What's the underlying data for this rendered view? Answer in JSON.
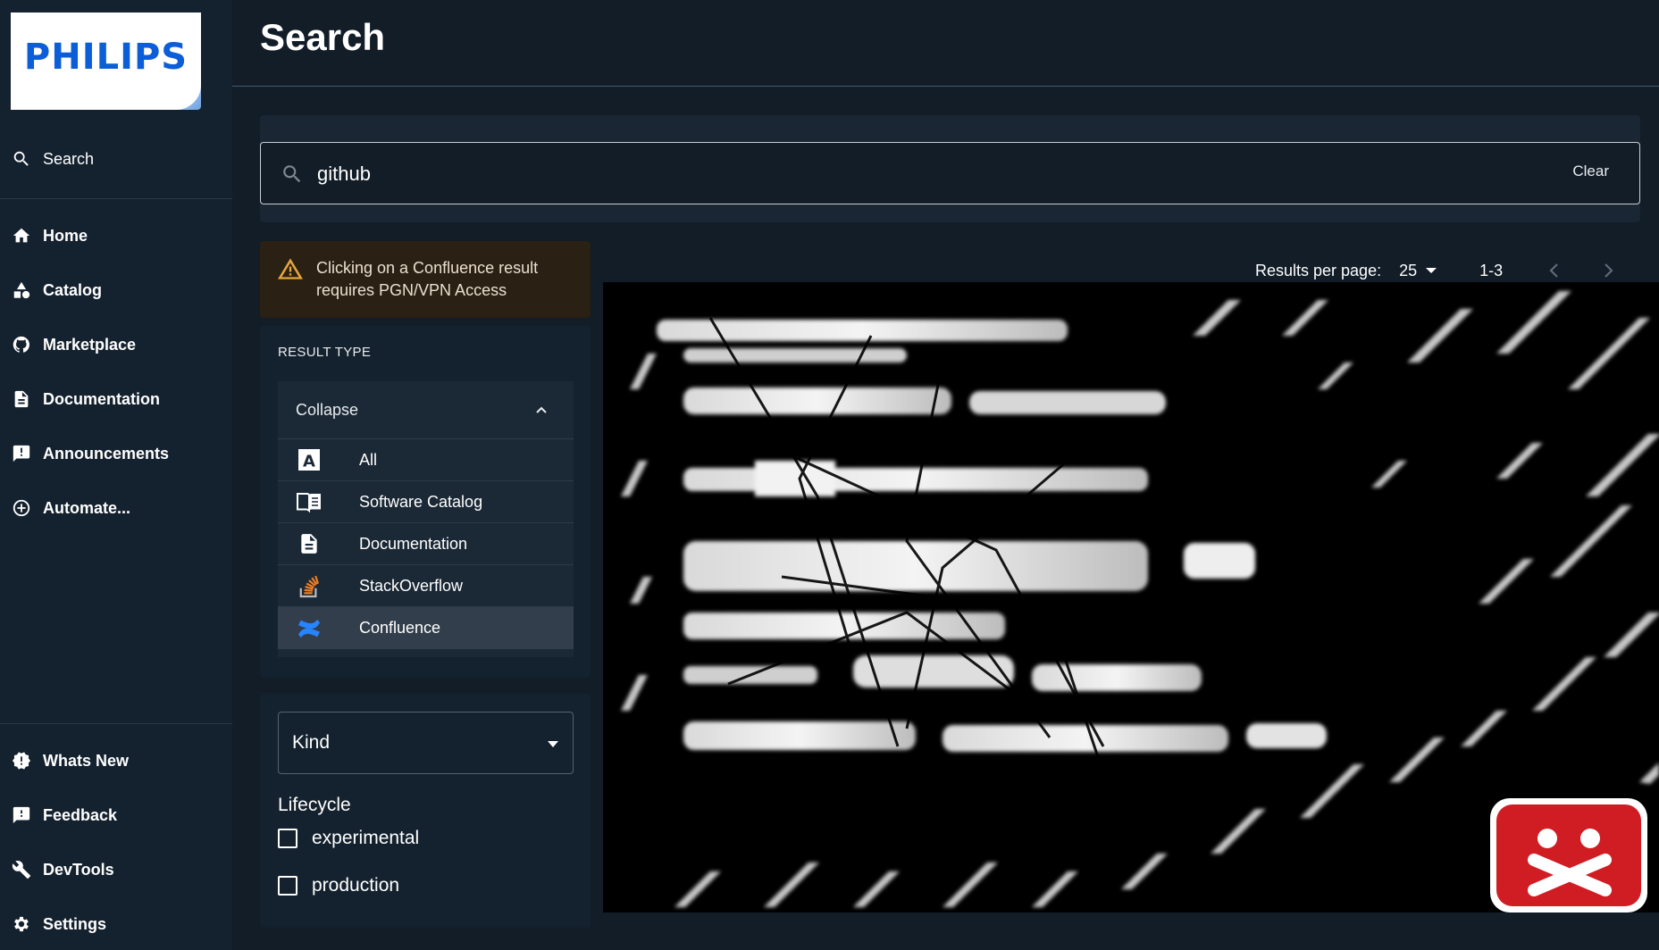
{
  "brand": {
    "logo_text": "PHILIPS"
  },
  "sidebar": {
    "search_label": "Search",
    "items": [
      {
        "label": "Home",
        "icon": "home-icon"
      },
      {
        "label": "Catalog",
        "icon": "catalog-icon"
      },
      {
        "label": "Marketplace",
        "icon": "github-icon"
      },
      {
        "label": "Documentation",
        "icon": "document-icon"
      },
      {
        "label": "Announcements",
        "icon": "announcement-icon"
      },
      {
        "label": "Automate...",
        "icon": "add-circle-icon"
      }
    ],
    "bottom_items": [
      {
        "label": "Whats New",
        "icon": "badge-alert-icon"
      },
      {
        "label": "Feedback",
        "icon": "feedback-icon"
      },
      {
        "label": "DevTools",
        "icon": "wrench-icon"
      },
      {
        "label": "Settings",
        "icon": "gear-icon"
      }
    ]
  },
  "header": {
    "title": "Search"
  },
  "search": {
    "value": "github",
    "clear_label": "Clear"
  },
  "notice": {
    "text": "Clicking on a Confluence result requires PGN/VPN Access",
    "icon": "warning-icon"
  },
  "filters": {
    "result_type_label": "RESULT TYPE",
    "collapse_label": "Collapse",
    "result_types": [
      {
        "label": "All",
        "icon": "letter-a-icon"
      },
      {
        "label": "Software Catalog",
        "icon": "book-icon"
      },
      {
        "label": "Documentation",
        "icon": "document-icon"
      },
      {
        "label": "StackOverflow",
        "icon": "stackoverflow-icon"
      },
      {
        "label": "Confluence",
        "icon": "confluence-icon",
        "selected": true
      }
    ],
    "kind_label": "Kind",
    "lifecycle_label": "Lifecycle",
    "lifecycle_options": [
      {
        "label": "experimental",
        "checked": false
      },
      {
        "label": "production",
        "checked": false
      }
    ]
  },
  "pagination": {
    "results_per_page_label": "Results per page:",
    "results_per_page": "25",
    "range": "1-3"
  },
  "colors": {
    "background": "#121d28",
    "sidebar": "#14212e",
    "warning": "#e7a63c",
    "selected_row": "#323e4b",
    "brand_blue": "#0b5ed7",
    "error_red": "#d01d24"
  }
}
